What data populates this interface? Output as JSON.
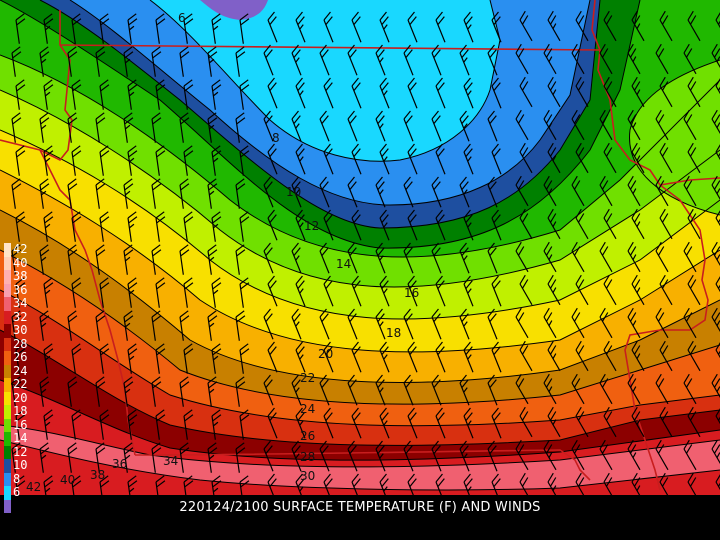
{
  "caption": "220124/2100 SURFACE TEMPERATURE (F) AND WINDS",
  "legend": [
    {
      "label": "42",
      "color": "#ffe4c8"
    },
    {
      "label": "40",
      "color": "#ffd0b8"
    },
    {
      "label": "38",
      "color": "#ffb0b0"
    },
    {
      "label": "36",
      "color": "#f8a0b0"
    },
    {
      "label": "34",
      "color": "#f06070"
    },
    {
      "label": "32",
      "color": "#d81c20"
    },
    {
      "label": "30",
      "color": "#8c0000"
    },
    {
      "label": "28",
      "color": "#d83010"
    },
    {
      "label": "26",
      "color": "#f06010"
    },
    {
      "label": "24",
      "color": "#c88000"
    },
    {
      "label": "22",
      "color": "#f8b000"
    },
    {
      "label": "20",
      "color": "#f8e000"
    },
    {
      "label": "18",
      "color": "#c0f000"
    },
    {
      "label": "16",
      "color": "#70e000"
    },
    {
      "label": "14",
      "color": "#20b800"
    },
    {
      "label": "12",
      "color": "#008000"
    },
    {
      "label": "10",
      "color": "#1e4fa0"
    },
    {
      "label": "8",
      "color": "#2a8ff0"
    },
    {
      "label": "6",
      "color": "#19d8ff"
    },
    {
      "label": "",
      "color": "#8060c8"
    }
  ],
  "contour_labels": [
    {
      "text": "6",
      "pos": "top"
    },
    {
      "text": "8"
    },
    {
      "text": "10"
    },
    {
      "text": "12"
    },
    {
      "text": "14"
    },
    {
      "text": "16"
    },
    {
      "text": "18"
    },
    {
      "text": "20"
    },
    {
      "text": "22"
    },
    {
      "text": "24"
    },
    {
      "text": "26"
    },
    {
      "text": "28"
    },
    {
      "text": "30"
    },
    {
      "text": "34"
    },
    {
      "text": "36"
    },
    {
      "text": "38"
    },
    {
      "text": "40"
    },
    {
      "text": "42"
    }
  ],
  "colors": {
    "background": "#000000",
    "border": "#c81e1e",
    "contour": "#000000",
    "barb": "#000000"
  },
  "barb_icon": "wind-barb-icon"
}
